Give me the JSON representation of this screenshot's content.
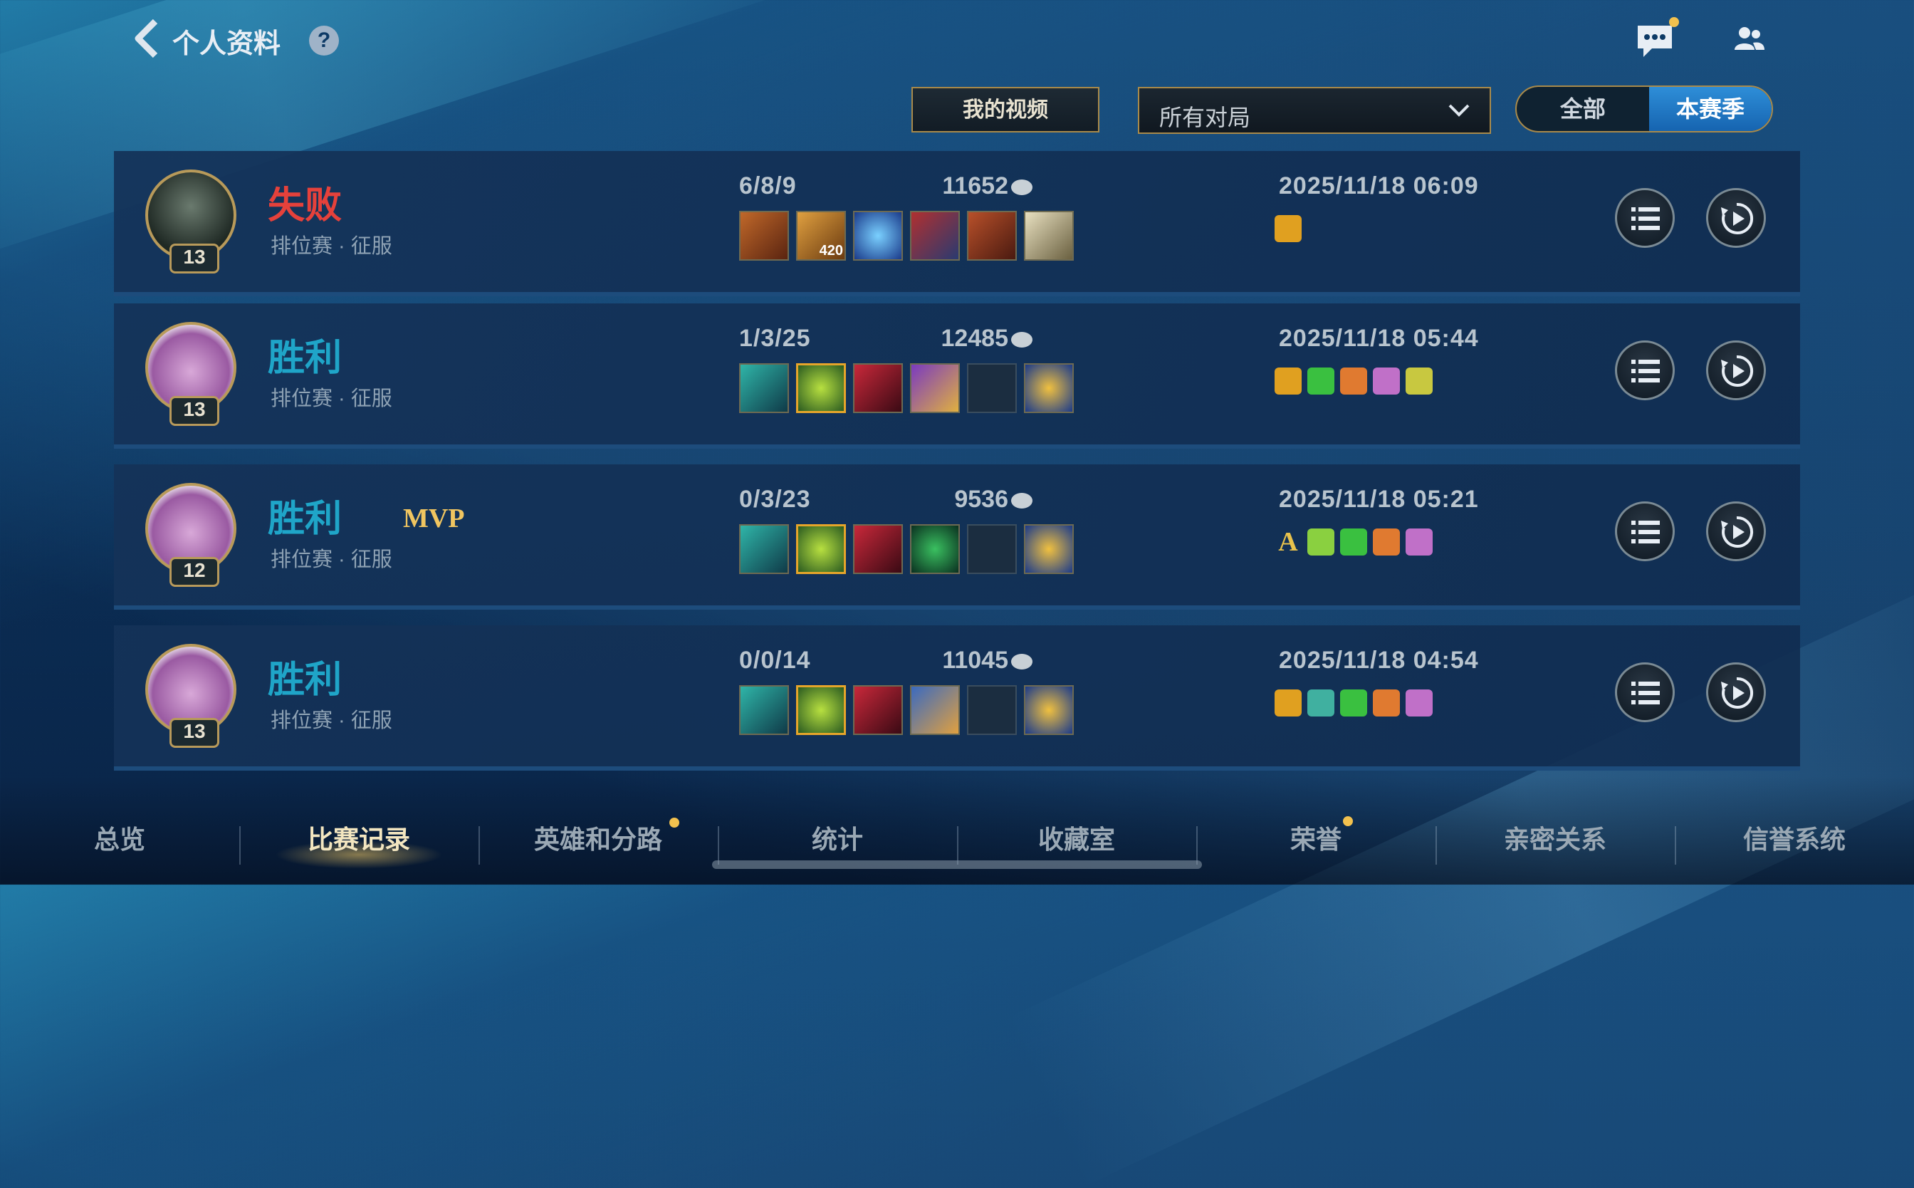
{
  "header": {
    "back_icon": "chevron-left-icon",
    "title": "个人资料",
    "help_label": "?",
    "chat_icon": "chat-bubble-icon",
    "friends_icon": "friends-icon"
  },
  "filters": {
    "my_videos_label": "我的视频",
    "match_filter_value": "所有对局",
    "season_toggle": [
      "全部",
      "本赛季"
    ],
    "season_selected": "本赛季"
  },
  "matches": [
    {
      "result": "失败",
      "level": "13",
      "mode": "排位赛 · 征服",
      "kda": "6/8/9",
      "gold": "11652",
      "datetime": "2025/11/18 06:09",
      "item_stack": "420",
      "mvp": ""
    },
    {
      "result": "胜利",
      "level": "13",
      "mode": "排位赛 · 征服",
      "kda": "1/3/25",
      "gold": "12485",
      "datetime": "2025/11/18 05:44",
      "mvp": ""
    },
    {
      "result": "胜利",
      "level": "12",
      "mode": "排位赛 · 征服",
      "kda": "0/3/23",
      "gold": "9536",
      "datetime": "2025/11/18 05:21",
      "mvp": "MVP",
      "badge_letter": "A"
    },
    {
      "result": "胜利",
      "level": "13",
      "mode": "排位赛 · 征服",
      "kda": "0/0/14",
      "gold": "11045",
      "datetime": "2025/11/18 04:54",
      "mvp": ""
    }
  ],
  "bottom_tabs": [
    "总览",
    "比赛记录",
    "英雄和分路",
    "统计",
    "收藏室",
    "荣誉",
    "亲密关系",
    "信誉系统"
  ],
  "active_tab": "比赛记录",
  "colors": {
    "loss": "#e5413b",
    "win": "#1fa5c8",
    "gold_border": "#a98a4a",
    "toggle_active": "#1e7ac8"
  }
}
